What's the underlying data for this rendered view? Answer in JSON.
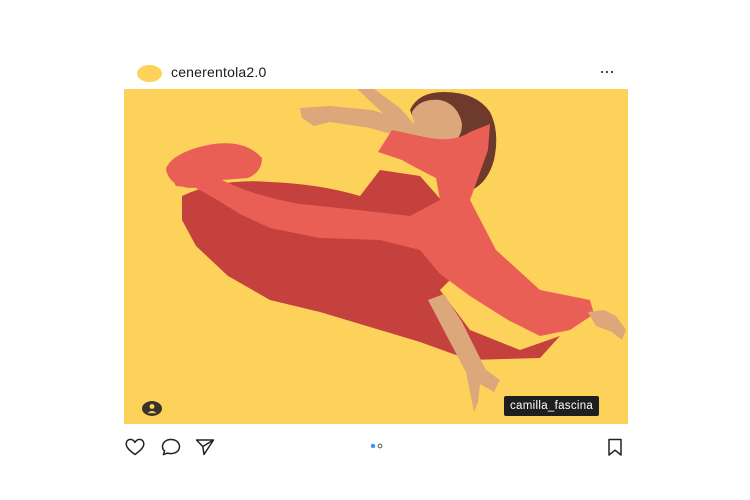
{
  "post": {
    "username": "cenerentola2.0",
    "tag_label": "camilla_fascina",
    "carousel": {
      "total": 2,
      "active": 1
    }
  },
  "icons": {
    "more": "more-horizontal-icon",
    "like": "heart-icon",
    "comment": "comment-bubble-icon",
    "share": "paper-plane-icon",
    "save": "bookmark-icon",
    "tagged_user": "user-tag-icon"
  },
  "colors": {
    "image_background": "#fdd25a",
    "dress_light": "#ea5f55",
    "dress_dark": "#c4413e",
    "skin": "#dca77a",
    "hair": "#6e3a2c",
    "carousel_active": "#3897f0",
    "tag_background": "#1f1f1f"
  }
}
